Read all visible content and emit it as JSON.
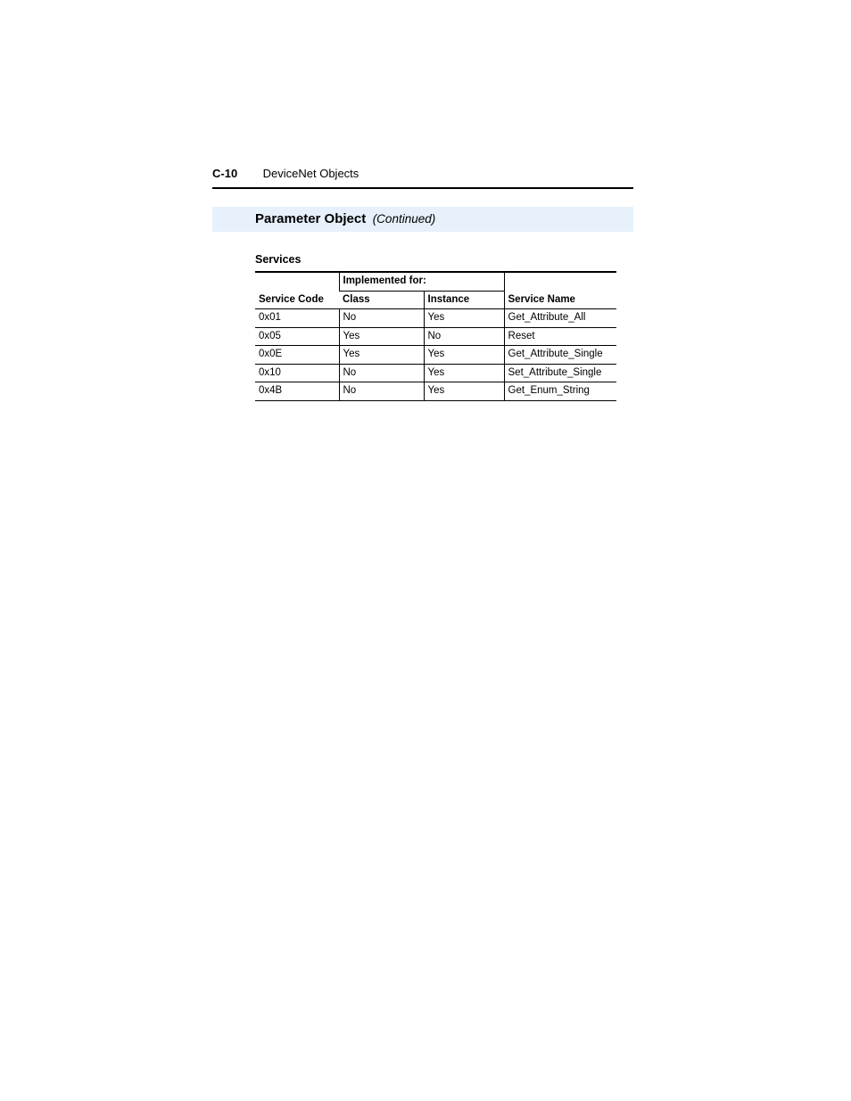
{
  "header": {
    "page_number": "C-10",
    "chapter_title": "DeviceNet Objects"
  },
  "title_band": {
    "title": "Parameter Object",
    "continuation": "(Continued)"
  },
  "section": {
    "label": "Services"
  },
  "table": {
    "columns": {
      "service_code": "Service Code",
      "implemented_for": "Implemented for:",
      "class": "Class",
      "instance": "Instance",
      "service_name": "Service Name"
    },
    "rows": [
      {
        "code": "0x01",
        "class": "No",
        "instance": "Yes",
        "name": "Get_Attribute_All"
      },
      {
        "code": "0x05",
        "class": "Yes",
        "instance": "No",
        "name": "Reset"
      },
      {
        "code": "0x0E",
        "class": "Yes",
        "instance": "Yes",
        "name": "Get_Attribute_Single"
      },
      {
        "code": "0x10",
        "class": "No",
        "instance": "Yes",
        "name": "Set_Attribute_Single"
      },
      {
        "code": "0x4B",
        "class": "No",
        "instance": "Yes",
        "name": "Get_Enum_String"
      }
    ]
  }
}
